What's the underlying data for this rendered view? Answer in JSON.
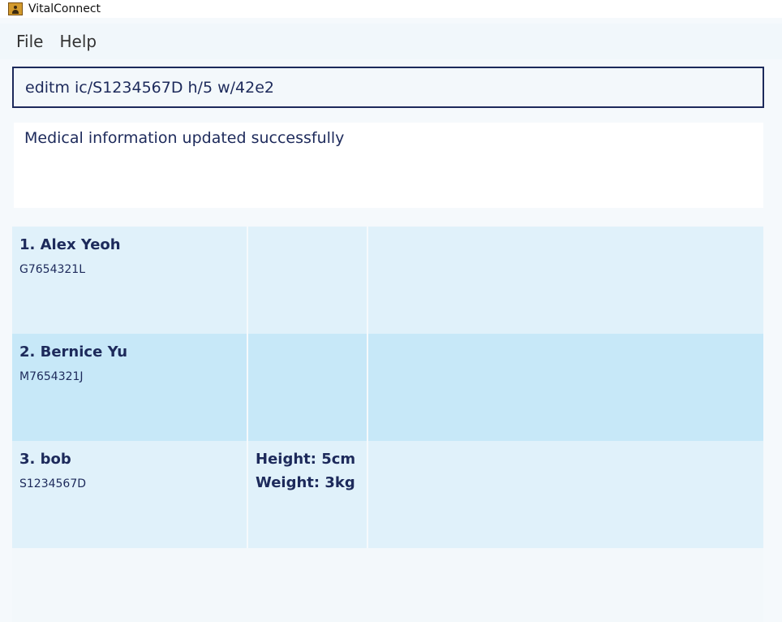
{
  "window": {
    "title": "VitalConnect"
  },
  "menu": {
    "items": [
      "File",
      "Help"
    ]
  },
  "command": {
    "value": "editm ic/S1234567D h/5 w/42e2"
  },
  "result": {
    "message": "Medical information updated successfully"
  },
  "patients": [
    {
      "name": "1. Alex Yeoh",
      "ic": "G7654321L",
      "height": "",
      "weight": ""
    },
    {
      "name": "2. Bernice Yu",
      "ic": "M7654321J",
      "height": "",
      "weight": ""
    },
    {
      "name": "3. bob",
      "ic": "S1234567D",
      "height": "Height: 5cm",
      "weight": "Weight: 3kg"
    }
  ],
  "colors": {
    "text": "#1d2a5b",
    "row_odd": "#e0f1fa",
    "row_even": "#c7e8f8"
  }
}
